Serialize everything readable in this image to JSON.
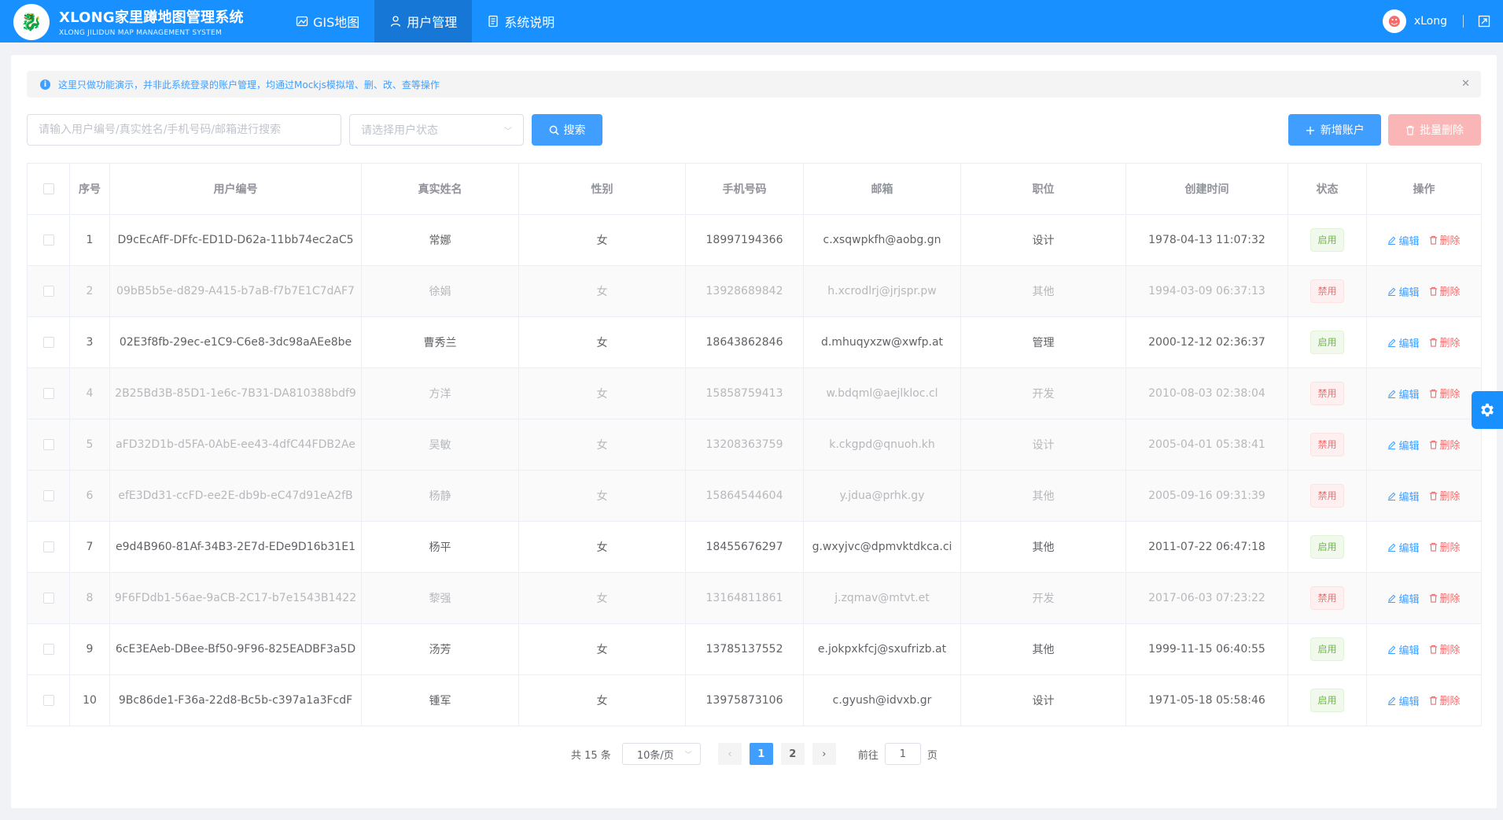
{
  "header": {
    "title": "XLONG家里蹲地图管理系统",
    "subtitle": "XLONG JILIDUN MAP MANAGEMENT SYSTEM",
    "nav": [
      {
        "label": "GIS地图",
        "icon": "map-icon"
      },
      {
        "label": "用户管理",
        "icon": "user-icon",
        "active": true
      },
      {
        "label": "系统说明",
        "icon": "document-icon"
      }
    ],
    "username": "xLong"
  },
  "alert": {
    "text": "这里只做功能演示，并非此系统登录的账户管理，均通过Mockjs模拟增、删、改、查等操作"
  },
  "toolbar": {
    "search_placeholder": "请输入用户编号/真实姓名/手机号码/邮箱进行搜索",
    "status_placeholder": "请选择用户状态",
    "search_label": "搜索",
    "add_label": "新增账户",
    "batch_delete_label": "批量删除"
  },
  "table": {
    "headers": [
      "序号",
      "用户编号",
      "真实姓名",
      "性别",
      "手机号码",
      "邮箱",
      "职位",
      "创建时间",
      "状态",
      "操作"
    ],
    "edit_label": "编辑",
    "delete_label": "删除",
    "rows": [
      {
        "no": "1",
        "id": "D9cEcAfF-DFfc-ED1D-D62a-11bb74ec2aC5",
        "name": "常娜",
        "gender": "女",
        "phone": "18997194366",
        "email": "c.xsqwpkfh@aobg.gn",
        "position": "设计",
        "created": "1978-04-13 11:07:32",
        "status": "启用",
        "enabled": true
      },
      {
        "no": "2",
        "id": "09bB5b5e-d829-A415-b7aB-f7b7E1C7dAF7",
        "name": "徐娟",
        "gender": "女",
        "phone": "13928689842",
        "email": "h.xcrodlrj@jrjspr.pw",
        "position": "其他",
        "created": "1994-03-09 06:37:13",
        "status": "禁用",
        "enabled": false
      },
      {
        "no": "3",
        "id": "02E3f8fb-29ec-e1C9-C6e8-3dc98aAEe8be",
        "name": "曹秀兰",
        "gender": "女",
        "phone": "18643862846",
        "email": "d.mhuqyxzw@xwfp.at",
        "position": "管理",
        "created": "2000-12-12 02:36:37",
        "status": "启用",
        "enabled": true
      },
      {
        "no": "4",
        "id": "2B25Bd3B-85D1-1e6c-7B31-DA810388bdf9",
        "name": "方洋",
        "gender": "女",
        "phone": "15858759413",
        "email": "w.bdqml@aejlkloc.cl",
        "position": "开发",
        "created": "2010-08-03 02:38:04",
        "status": "禁用",
        "enabled": false
      },
      {
        "no": "5",
        "id": "aFD32D1b-d5FA-0AbE-ee43-4dfC44FDB2Ae",
        "name": "吴敏",
        "gender": "女",
        "phone": "13208363759",
        "email": "k.ckgpd@qnuoh.kh",
        "position": "设计",
        "created": "2005-04-01 05:38:41",
        "status": "禁用",
        "enabled": false
      },
      {
        "no": "6",
        "id": "efE3Dd31-ccFD-ee2E-db9b-eC47d91eA2fB",
        "name": "杨静",
        "gender": "女",
        "phone": "15864544604",
        "email": "y.jdua@prhk.gy",
        "position": "其他",
        "created": "2005-09-16 09:31:39",
        "status": "禁用",
        "enabled": false
      },
      {
        "no": "7",
        "id": "e9d4B960-81Af-34B3-2E7d-EDe9D16b31E1",
        "name": "杨平",
        "gender": "女",
        "phone": "18455676297",
        "email": "g.wxyjvc@dpmvktdkca.ci",
        "position": "其他",
        "created": "2011-07-22 06:47:18",
        "status": "启用",
        "enabled": true
      },
      {
        "no": "8",
        "id": "9F6FDdb1-56ae-9aCB-2C17-b7e1543B1422",
        "name": "黎强",
        "gender": "女",
        "phone": "13164811861",
        "email": "j.zqmav@mtvt.et",
        "position": "开发",
        "created": "2017-06-03 07:23:22",
        "status": "禁用",
        "enabled": false
      },
      {
        "no": "9",
        "id": "6cE3EAeb-DBee-Bf50-9F96-825EADBF3a5D",
        "name": "汤芳",
        "gender": "女",
        "phone": "13785137552",
        "email": "e.jokpxkfcj@sxufrizb.at",
        "position": "其他",
        "created": "1999-11-15 06:40:55",
        "status": "启用",
        "enabled": true
      },
      {
        "no": "10",
        "id": "9Bc86de1-F36a-22d8-Bc5b-c397a1a3FcdF",
        "name": "锺军",
        "gender": "女",
        "phone": "13975873106",
        "email": "c.gyush@idvxb.gr",
        "position": "设计",
        "created": "1971-05-18 05:58:46",
        "status": "启用",
        "enabled": true
      }
    ]
  },
  "pagination": {
    "total": "共 15 条",
    "page_size": "10条/页",
    "pages": [
      "1",
      "2"
    ],
    "current": "1",
    "goto_label": "前往",
    "goto_value": "1",
    "page_suffix": "页"
  },
  "colors": {
    "primary": "#1890ff",
    "button": "#409eff",
    "enabled_tag": "#67c23a",
    "disabled_tag": "#f56c6c"
  }
}
